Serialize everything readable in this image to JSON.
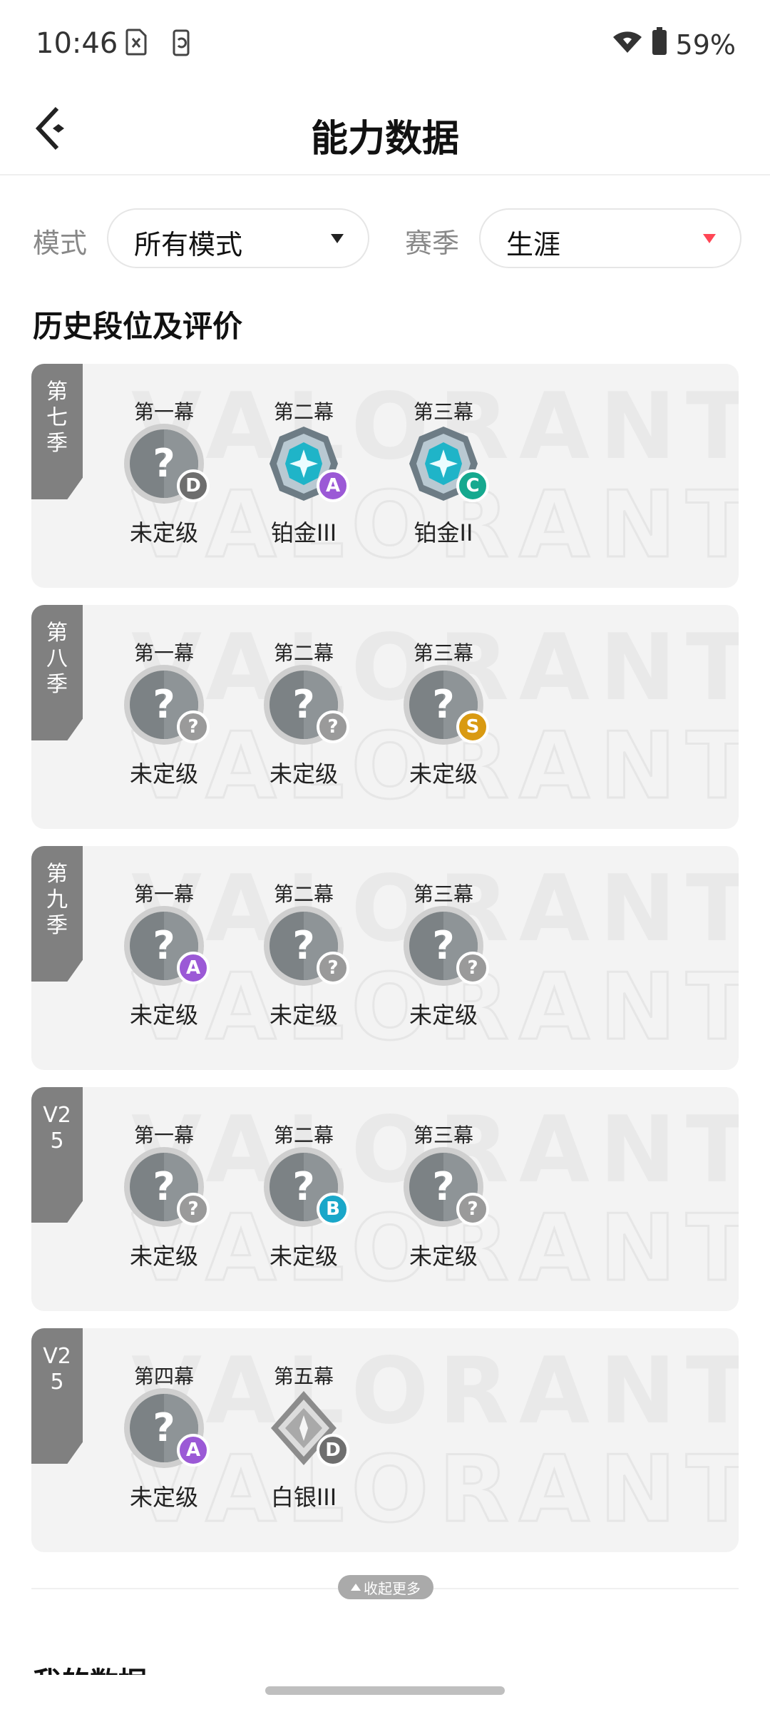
{
  "status_bar": {
    "time": "10:46",
    "battery": "59%"
  },
  "header": {
    "title": "能力数据"
  },
  "filters": {
    "mode_label": "模式",
    "mode_value": "所有模式",
    "season_label": "赛季",
    "season_value": "生涯"
  },
  "section_title": "历史段位及评价",
  "watermark_text": "VALORANT",
  "colors": {
    "accent_red": "#ff4655",
    "badge_D": "#6e6e6e",
    "badge_A": "#9b59d6",
    "badge_C": "#16a98f",
    "badge_S": "#d99a12",
    "badge_B": "#1aa7c9",
    "badge_unknown": "#9a9a9a"
  },
  "seasons": [
    {
      "tab": "第\n七\n季",
      "acts": [
        {
          "label": "第一幕",
          "rank": "未定级",
          "emblem": "unranked-icon",
          "grade": "D"
        },
        {
          "label": "第二幕",
          "rank": "铂金III",
          "emblem": "platinum-icon",
          "grade": "A"
        },
        {
          "label": "第三幕",
          "rank": "铂金II",
          "emblem": "platinum-icon",
          "grade": "C"
        }
      ]
    },
    {
      "tab": "第\n八\n季",
      "acts": [
        {
          "label": "第一幕",
          "rank": "未定级",
          "emblem": "unranked-icon",
          "grade": "?"
        },
        {
          "label": "第二幕",
          "rank": "未定级",
          "emblem": "unranked-icon",
          "grade": "?"
        },
        {
          "label": "第三幕",
          "rank": "未定级",
          "emblem": "unranked-icon",
          "grade": "S"
        }
      ]
    },
    {
      "tab": "第\n九\n季",
      "acts": [
        {
          "label": "第一幕",
          "rank": "未定级",
          "emblem": "unranked-icon",
          "grade": "A"
        },
        {
          "label": "第二幕",
          "rank": "未定级",
          "emblem": "unranked-icon",
          "grade": "?"
        },
        {
          "label": "第三幕",
          "rank": "未定级",
          "emblem": "unranked-icon",
          "grade": "?"
        }
      ]
    },
    {
      "tab": "V2\n5",
      "acts": [
        {
          "label": "第一幕",
          "rank": "未定级",
          "emblem": "unranked-icon",
          "grade": "?"
        },
        {
          "label": "第二幕",
          "rank": "未定级",
          "emblem": "unranked-icon",
          "grade": "B"
        },
        {
          "label": "第三幕",
          "rank": "未定级",
          "emblem": "unranked-icon",
          "grade": "?"
        }
      ]
    },
    {
      "tab": "V2\n5",
      "acts": [
        {
          "label": "第四幕",
          "rank": "未定级",
          "emblem": "unranked-icon",
          "grade": "A"
        },
        {
          "label": "第五幕",
          "rank": "白银III",
          "emblem": "silver-icon",
          "grade": "D"
        }
      ]
    }
  ],
  "collapse_label": "收起更多",
  "next_section_title": "我的数据"
}
